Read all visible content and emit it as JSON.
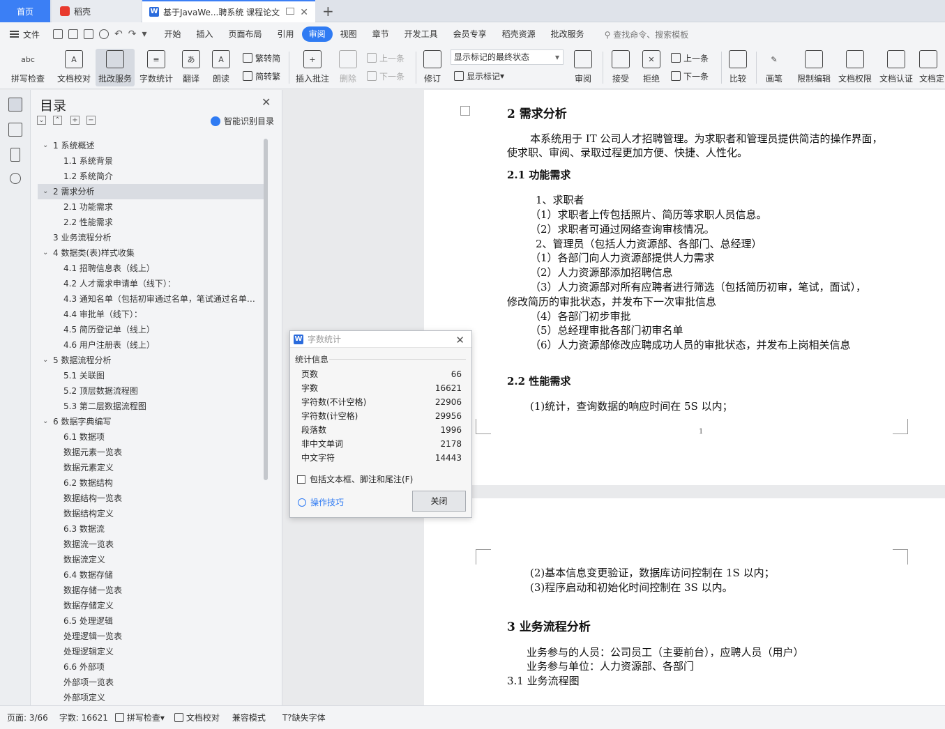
{
  "tabs": {
    "home": "首页",
    "daoke": "稻壳",
    "doc": "基于JavaWe...聘系统 课程论文",
    "add": "+"
  },
  "menu": {
    "file": "文件",
    "items": [
      "开始",
      "插入",
      "页面布局",
      "引用",
      "审阅",
      "视图",
      "章节",
      "开发工具",
      "会员专享",
      "稻壳资源",
      "批改服务"
    ],
    "search": "查找命令、搜索模板"
  },
  "ribbon": {
    "spell": "拼写检查",
    "proof": "文档校对",
    "correct": "批改服务",
    "wordcount": "字数统计",
    "translate": "翻译",
    "read": "朗读",
    "trad": "繁转简",
    "simp": "简转繁",
    "insert_comment": "插入批注",
    "delete": "删除",
    "prev": "上一条",
    "next": "下一条",
    "revise": "修订",
    "markup_state": "显示标记的最终状态",
    "show_markup": "显示标记",
    "review": "审阅",
    "accept": "接受",
    "reject": "拒绝",
    "prev2": "上一条",
    "next2": "下一条",
    "compare": "比较",
    "pen": "画笔",
    "restrict": "限制编辑",
    "rights": "文档权限",
    "certify": "文档认证",
    "more": "文档定"
  },
  "toc": {
    "title": "目录",
    "smart": "智能识别目录",
    "items": [
      {
        "label": "1   系统概述",
        "level": 1,
        "chev": true
      },
      {
        "label": "1.1  系统背景",
        "level": 2
      },
      {
        "label": "1.2  系统简介",
        "level": 2
      },
      {
        "label": "2   需求分析",
        "level": 1,
        "chev": true,
        "selected": true
      },
      {
        "label": "2.1  功能需求",
        "level": 2
      },
      {
        "label": "2.2  性能需求",
        "level": 2
      },
      {
        "label": "3   业务流程分析",
        "level": 1
      },
      {
        "label": "4   数据类(表)样式收集",
        "level": 1,
        "chev": true
      },
      {
        "label": "4.1  招聘信息表（线上）",
        "level": 2
      },
      {
        "label": "4.2  人才需求申请单（线下）：",
        "level": 2
      },
      {
        "label": "4.3  通知名单（包括初审通过名单，笔试通过名单…",
        "level": 2
      },
      {
        "label": "4.4  审批单（线下）：",
        "level": 2
      },
      {
        "label": "4.5  简历登记单（线上）",
        "level": 2
      },
      {
        "label": "4.6  用户注册表（线上）",
        "level": 2
      },
      {
        "label": "5   数据流程分析",
        "level": 1,
        "chev": true
      },
      {
        "label": "5.1  关联图",
        "level": 2
      },
      {
        "label": "5.2  顶层数据流程图",
        "level": 2
      },
      {
        "label": "5.3  第二层数据流程图",
        "level": 2
      },
      {
        "label": "6   数据字典编写",
        "level": 1,
        "chev": true
      },
      {
        "label": "6.1  数据项",
        "level": 2
      },
      {
        "label": "数据元素一览表",
        "level": 2
      },
      {
        "label": "数据元素定义",
        "level": 2
      },
      {
        "label": "6.2  数据结构",
        "level": 2
      },
      {
        "label": "数据结构一览表",
        "level": 2
      },
      {
        "label": "数据结构定义",
        "level": 2
      },
      {
        "label": "6.3  数据流",
        "level": 2
      },
      {
        "label": "数据流一览表",
        "level": 2
      },
      {
        "label": "数据流定义",
        "level": 2
      },
      {
        "label": "6.4  数据存储",
        "level": 2
      },
      {
        "label": "数据存储一览表",
        "level": 2
      },
      {
        "label": "数据存储定义",
        "level": 2
      },
      {
        "label": "6.5  处理逻辑",
        "level": 2
      },
      {
        "label": "处理逻辑一览表",
        "level": 2
      },
      {
        "label": "处理逻辑定义",
        "level": 2
      },
      {
        "label": "6.6  外部项",
        "level": 2
      },
      {
        "label": "外部项一览表",
        "level": 2
      },
      {
        "label": "外部项定义",
        "level": 2
      }
    ]
  },
  "document": {
    "h2": "2    需求分析",
    "p1a": "本系统用于 IT 公司人才招聘管理。为求职者和管理员提供简洁的操作界面，",
    "p1b": "使求职、审阅、录取过程更加方便、快捷、人性化。",
    "h21": "2.1  功能需求",
    "l1": "1、求职者",
    "l2": "（1）求职者上传包括照片、简历等求职人员信息。",
    "l3": "（2）求职者可通过网络查询审核情况。",
    "l4": "2、管理员（包括人力资源部、各部门、总经理）",
    "l5": "（1）各部门向人力资源部提供人力需求",
    "l6": "（2）人力资源部添加招聘信息",
    "l7": "（3）人力资源部对所有应聘者进行筛选（包括简历初审，笔试，面试），",
    "l7b": "修改简历的审批状态，并发布下一次审批信息",
    "l8": "（4）各部门初步审批",
    "l9": "（5）总经理审批各部门初审名单",
    "l10": "（6）人力资源部修改应聘成功人员的审批状态，并发布上岗相关信息",
    "h22": "2.2  性能需求",
    "perf1": "(1)统计，查询数据的响应时间在 5S 以内；",
    "page_number": "1",
    "perf2": "(2)基本信息变更验证，数据库访问控制在 1S 以内；",
    "perf3": "(3)程序启动和初始化时间控制在 3S 以内。",
    "h3": "3    业务流程分析",
    "b1": "业务参与的人员：公司员工（主要前台），应聘人员（用户）",
    "b2": "业务参与单位：人力资源部、各部门",
    "b3": "3.1 业务流程图"
  },
  "wordcount": {
    "title": "字数统计",
    "section": "统计信息",
    "rows": [
      {
        "label": "页数",
        "value": "66"
      },
      {
        "label": "字数",
        "value": "16621"
      },
      {
        "label": "字符数(不计空格)",
        "value": "22906"
      },
      {
        "label": "字符数(计空格)",
        "value": "29956"
      },
      {
        "label": "段落数",
        "value": "1996"
      },
      {
        "label": "非中文单词",
        "value": "2178"
      },
      {
        "label": "中文字符",
        "value": "14443"
      }
    ],
    "include": "包括文本框、脚注和尾注(F)",
    "tips": "操作技巧",
    "close": "关闭"
  },
  "status": {
    "page": "页面: 3/66",
    "words": "字数: 16621",
    "spell": "拼写检查",
    "proof": "文档校对",
    "compat": "兼容模式",
    "font": "缺失字体"
  }
}
